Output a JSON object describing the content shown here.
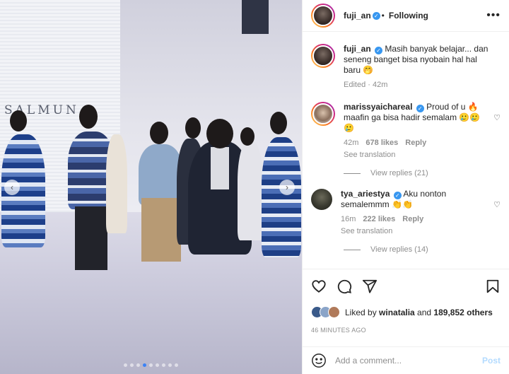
{
  "colors": {
    "accent": "#0095f6",
    "verified": "#3897f0",
    "text": "#262626",
    "muted": "#8e8e8e"
  },
  "media": {
    "brand_text": "SALMUN",
    "carousel_prev_icon": "chevron-left-icon",
    "carousel_next_icon": "chevron-right-icon",
    "slide_count": 9,
    "active_slide": 4
  },
  "header": {
    "username": "fuji_an",
    "follow_status": "Following",
    "more_icon": "more-horizontal-icon"
  },
  "caption": {
    "username": "fuji_an",
    "text": "Masih banyak belajar... dan seneng banget bisa nyobain hal hal baru 🤭",
    "meta": "Edited · 42m"
  },
  "comments": [
    {
      "username": "marissyaichareal",
      "text": "Proud of u 🔥 maafin ga bisa hadir semalam 🥲🥲🥲",
      "time": "42m",
      "likes": "678 likes",
      "reply": "Reply",
      "translation": "See translation",
      "view_replies": "View replies (21)"
    },
    {
      "username": "tya_ariestya",
      "text": "Aku nonton semalemmm 👏👏",
      "time": "16m",
      "likes": "222 likes",
      "reply": "Reply",
      "translation": "See translation",
      "view_replies": "View replies (14)"
    }
  ],
  "actions": {
    "like_icon": "heart-icon",
    "comment_icon": "comment-icon",
    "share_icon": "share-icon",
    "save_icon": "bookmark-icon"
  },
  "likes": {
    "prefix": "Liked by ",
    "user": "winatalia",
    "middle": " and ",
    "count": "189,852 others"
  },
  "timestamp": "46 MINUTES AGO",
  "add_comment": {
    "placeholder": "Add a comment...",
    "post_label": "Post",
    "emoji_icon": "emoji-icon"
  }
}
